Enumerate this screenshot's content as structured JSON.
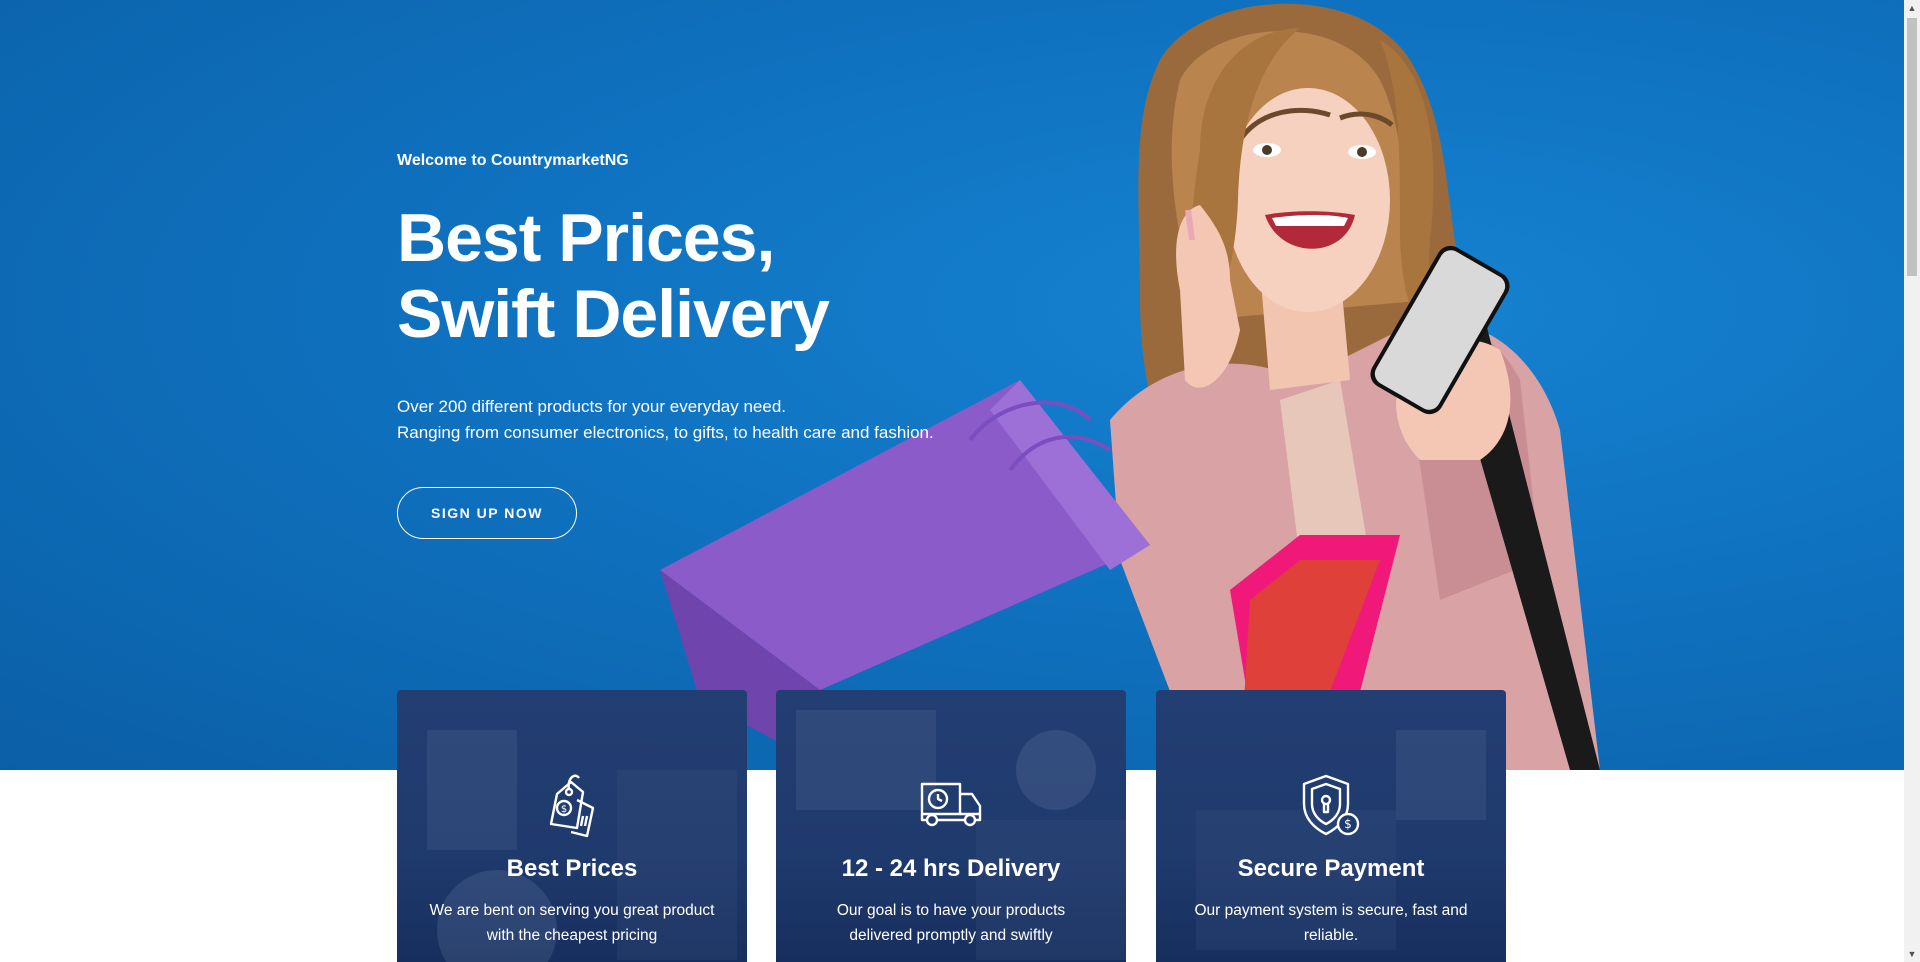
{
  "hero": {
    "eyebrow": "Welcome to CountrymarketNG",
    "headline_line1": "Best Prices,",
    "headline_line2": "Swift Delivery",
    "desc_line1": "Over 200 different products for your everyday need.",
    "desc_line2": "Ranging from consumer electronics, to gifts, to health care and fashion.",
    "cta_label": "SIGN UP NOW"
  },
  "features": [
    {
      "title": "Best Prices",
      "text": "We are bent on serving you great product with the cheapest pricing",
      "icon": "price-tag-icon"
    },
    {
      "title": "12 - 24 hrs Delivery",
      "text": "Our goal is to have your products delivered promptly and swiftly",
      "icon": "delivery-truck-icon"
    },
    {
      "title": "Secure Payment",
      "text": "Our payment system is secure, fast and reliable.",
      "icon": "shield-payment-icon"
    }
  ],
  "colors": {
    "hero_blue": "#0f72c0",
    "card_navy": "#1f3a6d",
    "bag_purple": "#8a5bc9",
    "bag_pink": "#f0197a",
    "bag_red": "#e0403a"
  },
  "illustration": "woman-with-shopping-bags-and-phone"
}
